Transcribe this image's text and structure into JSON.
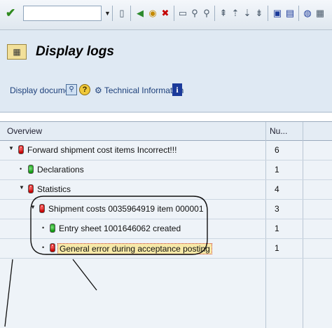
{
  "toolbar": {
    "command_value": "",
    "icons": [
      "enter-icon",
      "save-icon",
      "back-icon",
      "exit-icon",
      "cancel-icon",
      "print-icon",
      "find-icon",
      "find-next-icon",
      "first-page-icon",
      "prev-page-icon",
      "next-page-icon",
      "last-page-icon",
      "new-session-icon",
      "shortcut-icon",
      "help-icon",
      "layout-icon"
    ]
  },
  "title": {
    "text": "Display logs"
  },
  "app_toolbar": {
    "display_document": "Display document",
    "technical_information": "Technical Information",
    "info_glyph": "i"
  },
  "table": {
    "headers": {
      "overview": "Overview",
      "number": "Nu..."
    },
    "rows": [
      {
        "level": 0,
        "expanded": true,
        "status": "red",
        "text": "Forward shipment cost items Incorrect!!!",
        "number": "6"
      },
      {
        "level": 1,
        "expanded": false,
        "status": "green",
        "text": "Declarations",
        "number": "1"
      },
      {
        "level": 1,
        "expanded": true,
        "status": "red",
        "text": "Statistics",
        "number": "4"
      },
      {
        "level": 2,
        "expanded": true,
        "status": "red",
        "text": "Shipment costs 0035964919 item 000001",
        "number": "3"
      },
      {
        "level": 3,
        "expanded": false,
        "status": "green",
        "text": "Entry sheet 1001646062 created",
        "number": "1"
      },
      {
        "level": 3,
        "expanded": false,
        "status": "red",
        "text": "General error during acceptance posting",
        "number": "1",
        "highlighted": true
      }
    ]
  },
  "colors": {
    "accent": "#1b3a9a",
    "error": "#c40000",
    "success": "#0f9a0f",
    "highlight": "#f7e9a8"
  }
}
